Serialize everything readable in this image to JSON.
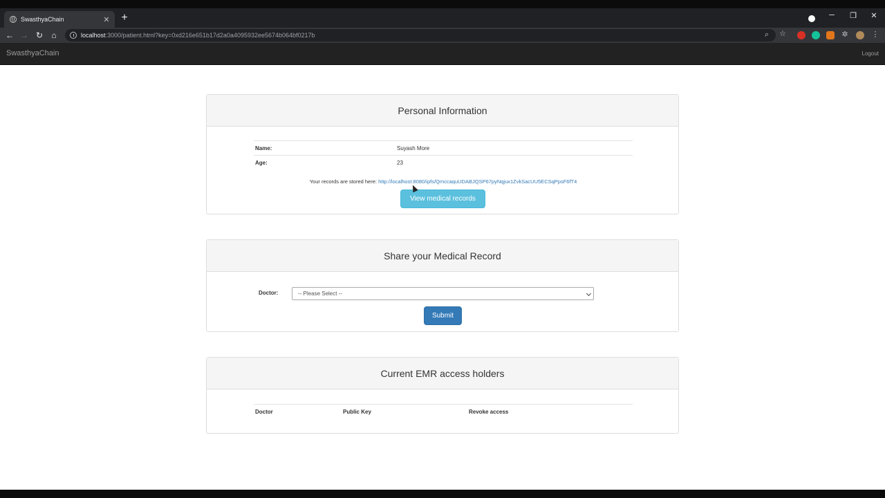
{
  "browser": {
    "tab_title": "SwasthyaChain",
    "url_host": "localhost",
    "url_path": ":3000/patient.html?key=0xd216e651b17d2a0a4095932ee5674b064bf0217b"
  },
  "navbar": {
    "brand": "SwasthyaChain",
    "logout": "Logout"
  },
  "personal_info": {
    "heading": "Personal Information",
    "name_label": "Name:",
    "name_value": "Suyash More",
    "age_label": "Age:",
    "age_value": "23",
    "records_prefix": "Your records are stored here:",
    "records_link": "http://localhost:8080/ipfs/QmccaquUDABJQSP67pyNqjux1ZvkSacUU5ECSqPpsF6fT4",
    "view_button": "View medical records"
  },
  "share": {
    "heading": "Share your Medical Record",
    "doctor_label": "Doctor:",
    "doctor_selected": "-- Please Select --",
    "submit_button": "Submit"
  },
  "access_holders": {
    "heading": "Current EMR access holders",
    "columns": [
      "Doctor",
      "Public Key",
      "Revoke access"
    ]
  },
  "colors": {
    "info_button": "#5bc0de",
    "primary_button": "#337ab7",
    "navbar_bg": "#222222"
  }
}
